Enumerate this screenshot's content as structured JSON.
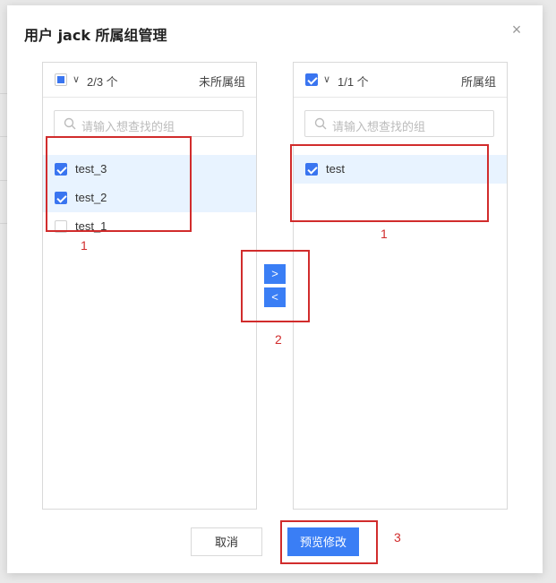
{
  "dialog": {
    "title": "用户 jack 所属组管理",
    "close_label": "×"
  },
  "left_panel": {
    "count_label": "2/3 个",
    "title": "未所属组",
    "search_placeholder": "请输入想查找的组",
    "items": [
      {
        "label": "test_3",
        "checked": true
      },
      {
        "label": "test_2",
        "checked": true
      },
      {
        "label": "test_1",
        "checked": false
      }
    ]
  },
  "right_panel": {
    "count_label": "1/1 个",
    "title": "所属组",
    "search_placeholder": "请输入想查找的组",
    "items": [
      {
        "label": "test",
        "checked": true
      }
    ]
  },
  "transfer": {
    "to_right": ">",
    "to_left": "<"
  },
  "footer": {
    "cancel_label": "取消",
    "preview_label": "预览修改"
  },
  "annotations": {
    "left_list": "1",
    "right_list": "1",
    "transfer_buttons": "2",
    "preview_button": "3"
  },
  "colors": {
    "primary": "#3a7ef5",
    "selected_row": "#e8f3ff",
    "annotation": "#d12c2c"
  }
}
